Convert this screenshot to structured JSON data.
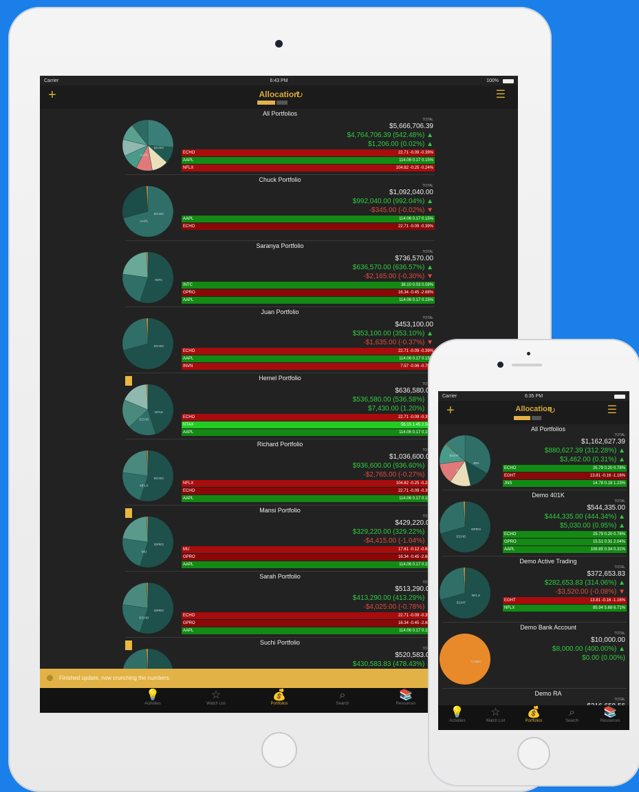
{
  "app": {
    "title": "Allocation",
    "colors": {
      "accent": "#d9a937",
      "gain": "#2ecc40",
      "loss": "#e24a3a"
    }
  },
  "ipad": {
    "status": {
      "carrier": "Carrier",
      "time": "6:43 PM",
      "battery": "100%"
    },
    "total_label": "TOTAL",
    "portfolios": [
      {
        "name": "All Portfolios",
        "total": "$5,666,706.39",
        "gain": "$4,764,706.39 (542.48%)",
        "day": "$1,206.00 (0.02%)",
        "gain_dir": "up",
        "day_dir": "up",
        "rows": [
          {
            "sym": "ECHO",
            "vals": "22.71   -0.09   -0.39%",
            "c": "red"
          },
          {
            "sym": "AAPL",
            "vals": "114.06   0.17   0.15%",
            "c": "green"
          },
          {
            "sym": "NFLX",
            "vals": "104.82   -0.25   -0.24%",
            "c": "red"
          }
        ],
        "pie_labels": [
          "ECHO",
          "AAPL"
        ],
        "pie": [
          "#3a7f77",
          "#1f5a52",
          "#eadfb9",
          "#e07a7a",
          "#4a9a8a",
          "#8fb8ae",
          "#5aa090",
          "#e89b3a",
          "#2c6b63"
        ]
      },
      {
        "name": "Chuck Portfolio",
        "total": "$1,092,040.00",
        "gain": "$992,040.00 (992.04%)",
        "day": "-$345.00 (-0.02%)",
        "gain_dir": "up",
        "day_dir": "down",
        "rows": [
          {
            "sym": "AAPL",
            "vals": "114.06   0.17   0.15%",
            "c": "green"
          },
          {
            "sym": "ECHO",
            "vals": "22.71   -0.09   -0.39%",
            "c": "red"
          }
        ],
        "pie_labels": [
          "ECHO",
          "AAPL"
        ],
        "pie": [
          "#2f6f67",
          "#1d4d48",
          "#e89b3a"
        ]
      },
      {
        "name": "Saranya Portfolio",
        "total": "$736,570.00",
        "gain": "$636,570.00 (636.57%)",
        "day": "-$2,165.00 (-0.30%)",
        "gain_dir": "up",
        "day_dir": "down",
        "rows": [
          {
            "sym": "INTC",
            "vals": "38.10   0.03   0.08%",
            "c": "green"
          },
          {
            "sym": "GPRO",
            "vals": "16.34   -0.45   -2.68%",
            "c": "red"
          },
          {
            "sym": "AAPL",
            "vals": "114.06   0.17   0.15%",
            "c": "green"
          }
        ],
        "pie_labels": [
          "INTC"
        ],
        "pie": [
          "#1f514c",
          "#2f6f67",
          "#6aa898",
          "#e89b3a"
        ]
      },
      {
        "name": "Juan Portfolio",
        "total": "$453,100.00",
        "gain": "$353,100.00 (353.10%)",
        "day": "-$1,635.00 (-0.37%)",
        "gain_dir": "up",
        "day_dir": "down",
        "rows": [
          {
            "sym": "ECHO",
            "vals": "22.71   -0.09   -0.39%",
            "c": "red"
          },
          {
            "sym": "AAPL",
            "vals": "114.06   0.17   0.15%",
            "c": "green"
          },
          {
            "sym": "INVN",
            "vals": "7.57   -0.06   -0.79%",
            "c": "red"
          }
        ],
        "pie_labels": [
          "ECHO"
        ],
        "pie": [
          "#1f514c",
          "#2f6f67",
          "#e89b3a"
        ]
      },
      {
        "name": "Hemel Portfolio",
        "total": "$636,580.00",
        "gain": "$536,580.00 (536.58%)",
        "day": "$7,430.00 (1.20%)",
        "gain_dir": "up",
        "day_dir": "up",
        "locked": true,
        "rows": [
          {
            "sym": "ECHO",
            "vals": "22.71   -0.09   -0.39%",
            "c": "red"
          },
          {
            "sym": "NTAX",
            "vals": "58.15   1.45   2.56%",
            "c": "lgreen"
          },
          {
            "sym": "AAPL",
            "vals": "114.06   0.17   0.15%",
            "c": "green"
          }
        ],
        "pie_labels": [
          "NTAX",
          "ECHO"
        ],
        "pie": [
          "#1f514c",
          "#2f6f67",
          "#4a8a7e",
          "#8fb8ae",
          "#e89b3a"
        ]
      },
      {
        "name": "Richard Portfolio",
        "total": "$1,036,600.00",
        "gain": "$936,600.00 (936.60%)",
        "day": "-$2,765.00 (-0.27%)",
        "gain_dir": "up",
        "day_dir": "down",
        "rows": [
          {
            "sym": "NFLX",
            "vals": "104.82   -0.25   -0.24%",
            "c": "red"
          },
          {
            "sym": "ECHO",
            "vals": "22.71   -0.09   -0.39%",
            "c": "red"
          },
          {
            "sym": "AAPL",
            "vals": "114.06   0.17   0.15%",
            "c": "green"
          }
        ],
        "pie_labels": [
          "ECHO",
          "NFLX"
        ],
        "pie": [
          "#1f514c",
          "#2f6f67",
          "#4a8a7e",
          "#e89b3a"
        ]
      },
      {
        "name": "Mansi Portfolio",
        "total": "$429,220.00",
        "gain": "$329,220.00 (329.22%)",
        "day": "-$4,415.00 (-1.04%)",
        "gain_dir": "up",
        "day_dir": "down",
        "locked": true,
        "rows": [
          {
            "sym": "MU",
            "vals": "17.61   -0.12   -0.68%",
            "c": "red"
          },
          {
            "sym": "GPRO",
            "vals": "16.34   -0.45   -2.68%",
            "c": "red"
          },
          {
            "sym": "AAPL",
            "vals": "114.06   0.17   0.15%",
            "c": "green"
          }
        ],
        "pie_labels": [
          "GPRO",
          "MU"
        ],
        "pie": [
          "#1f514c",
          "#2f6f67",
          "#5a9a8c",
          "#e89b3a"
        ]
      },
      {
        "name": "Sarah Portfolio",
        "total": "$513,290.00",
        "gain": "$413,290.00 (413.29%)",
        "day": "-$4,025.00 (-0.78%)",
        "gain_dir": "up",
        "day_dir": "down",
        "rows": [
          {
            "sym": "ECHO",
            "vals": "22.71   -0.09   -0.39%",
            "c": "red"
          },
          {
            "sym": "GPRO",
            "vals": "16.34   -0.45   -2.68%",
            "c": "red"
          },
          {
            "sym": "AAPL",
            "vals": "114.06   0.17   0.15%",
            "c": "green"
          }
        ],
        "pie_labels": [
          "GPRO",
          "ECHO"
        ],
        "pie": [
          "#1f514c",
          "#2f6f67",
          "#4a8a7e",
          "#e89b3a"
        ]
      },
      {
        "name": "Suchi Portfolio",
        "total": "$520,583.00",
        "gain": "$430,583.83 (478.43%)",
        "day": "$10,600.00 (2.05%)",
        "gain_dir": "up",
        "day_dir": "up",
        "locked": true,
        "rows": [],
        "pie_labels": [
          "NFLX"
        ],
        "pie": [
          "#1f514c",
          "#2f6f67",
          "#e89b3a"
        ]
      }
    ],
    "toast": "Finished update, now crunching the numbers.",
    "tabs": [
      {
        "label": "Activities",
        "icon": "💡"
      },
      {
        "label": "Watch List",
        "icon": "☆"
      },
      {
        "label": "Portfolios",
        "icon": "💰"
      },
      {
        "label": "Search",
        "icon": "⌕"
      },
      {
        "label": "Resources",
        "icon": "📚"
      }
    ]
  },
  "iphone": {
    "status": {
      "carrier": "Carrier",
      "time": "6:35 PM"
    },
    "total_label": "TOTAL",
    "portfolios": [
      {
        "name": "All Portfolios",
        "total": "$1,162,627.39",
        "gain": "$880,627.39 (312.28%)",
        "day": "$3,462.00 (0.31%)",
        "gain_dir": "up",
        "day_dir": "up",
        "rows": [
          {
            "sym": "ECHO",
            "vals": "25.79   0.20   0.78%",
            "c": "green"
          },
          {
            "sym": "EGHT",
            "vals": "13.81   -0.16   -1.16%",
            "c": "red"
          },
          {
            "sym": "JNS",
            "vals": "14.78   0.18   1.23%",
            "c": "green"
          }
        ],
        "pie_labels": [
          "JNS",
          "ECHO",
          "EGHT"
        ],
        "pie": [
          "#2f6f67",
          "#1d4d48",
          "#eadfb9",
          "#e07a7a",
          "#4a9a8a",
          "#e89b3a",
          "#3a7f77"
        ]
      },
      {
        "name": "Demo 401K",
        "total": "$544,335.00",
        "gain": "$444,335.00 (444.34%)",
        "day": "$5,030.00 (0.95%)",
        "gain_dir": "up",
        "day_dir": "up",
        "rows": [
          {
            "sym": "ECHO",
            "vals": "25.79   0.20   0.78%",
            "c": "green"
          },
          {
            "sym": "GPRO",
            "vals": "15.51   0.31   2.04%",
            "c": "green"
          },
          {
            "sym": "AAPL",
            "vals": "108.85   0.34   0.31%",
            "c": "green"
          }
        ],
        "pie_labels": [
          "GPRO",
          "ECHO"
        ],
        "pie": [
          "#1f514c",
          "#2f6f67",
          "#e89b3a"
        ]
      },
      {
        "name": "Demo Active Trading",
        "total": "$372,653.83",
        "gain": "$282,653.83 (314.06%)",
        "day": "-$3,520.00 (-0.08%)",
        "gain_dir": "up",
        "day_dir": "down",
        "rows": [
          {
            "sym": "EGHT",
            "vals": "13.81   -0.16   -1.16%",
            "c": "red"
          },
          {
            "sym": "NFLX",
            "vals": "85.94   5.68   6.71%",
            "c": "green"
          }
        ],
        "pie_labels": [
          "NFLX",
          "EGHT"
        ],
        "pie": [
          "#1f514c",
          "#2f6f67",
          "#e89b3a"
        ]
      },
      {
        "name": "Demo Bank Account",
        "total": "$10,000.00",
        "gain": "$8,000.00 (400.00%)",
        "day": "$0.00 (0.00%)",
        "gain_dir": "up",
        "day_dir": "flat",
        "rows": [],
        "pie_labels": [
          "CASH"
        ],
        "pie": [
          "#e88a2a"
        ]
      },
      {
        "name": "Demo RA",
        "total": "$316,658.56",
        "gain": "",
        "day": "",
        "gain_dir": "flat",
        "day_dir": "flat",
        "rows": [],
        "pie_labels": [],
        "pie": []
      }
    ],
    "tabs": [
      {
        "label": "Activities",
        "icon": "💡"
      },
      {
        "label": "Watch List",
        "icon": "☆"
      },
      {
        "label": "Portfolios",
        "icon": "💰"
      },
      {
        "label": "Search",
        "icon": "⌕"
      },
      {
        "label": "Resources",
        "icon": "📚"
      }
    ]
  }
}
